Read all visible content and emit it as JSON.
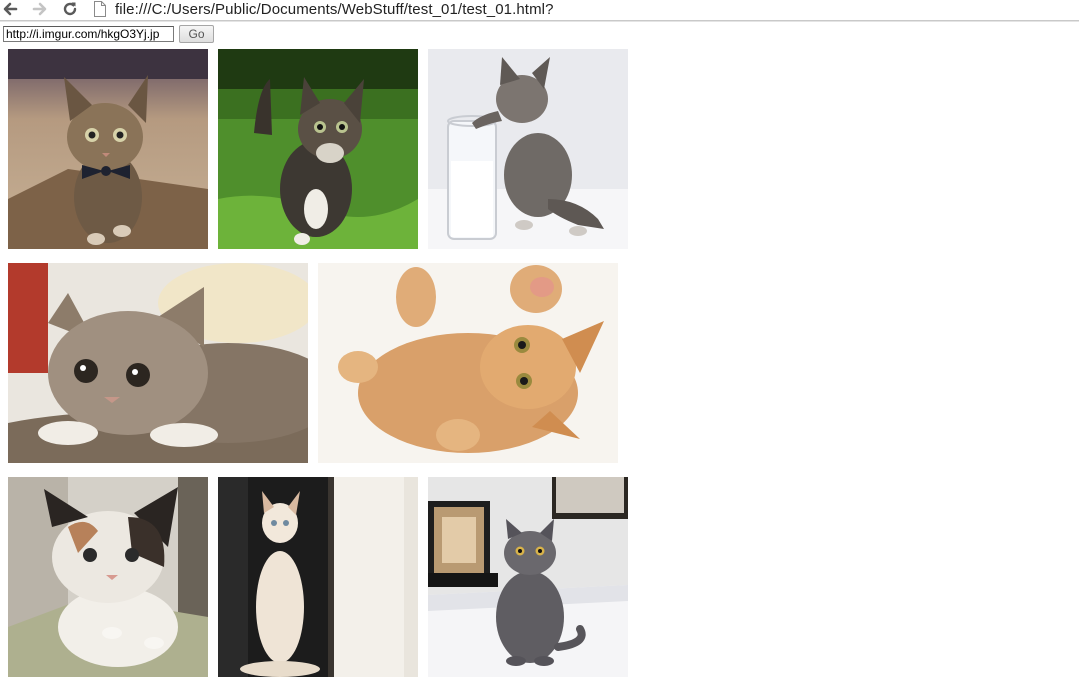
{
  "browser": {
    "address_bar_url": "file:///C:/Users/Public/Documents/WebStuff/test_01/test_01.html?"
  },
  "form": {
    "url_input_value": "http://i.imgur.com/hkgO3Yj.jp",
    "go_label": "Go"
  },
  "gallery": {
    "rows": [
      {
        "images": [
          "kitten-bowtie",
          "kitten-grass",
          "kitten-milk-glass"
        ]
      },
      {
        "images": [
          "kitten-lying-blanket",
          "kitten-rolling-paws-up"
        ]
      },
      {
        "images": [
          "kitten-calico",
          "cat-white-longhair",
          "cat-gray-bed"
        ]
      }
    ]
  },
  "icons": {
    "back": "arrow-left-icon",
    "forward": "arrow-right-icon",
    "reload": "reload-icon",
    "page": "page-document-icon"
  }
}
